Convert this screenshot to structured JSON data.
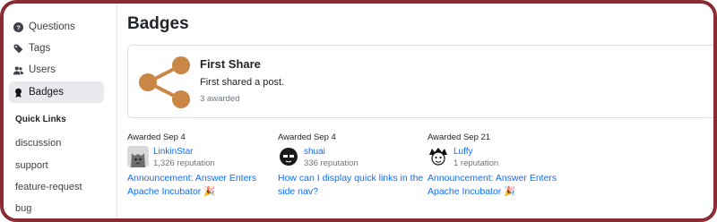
{
  "sidebar": {
    "items": [
      {
        "label": "Questions",
        "icon": "question-circle-icon"
      },
      {
        "label": "Tags",
        "icon": "tag-icon"
      },
      {
        "label": "Users",
        "icon": "people-icon"
      },
      {
        "label": "Badges",
        "icon": "award-icon"
      }
    ],
    "active": "Badges",
    "quick_links_title": "Quick Links",
    "quick_links": [
      "discussion",
      "support",
      "feature-request",
      "bug"
    ]
  },
  "main": {
    "title": "Badges",
    "badge": {
      "name": "First Share",
      "description": "First shared a post.",
      "awarded_count": "3 awarded",
      "icon": "share-icon",
      "icon_color": "#c98645"
    },
    "awards": [
      {
        "date": "Awarded Sep 4",
        "user": "LinkinStar",
        "reputation": "1,326 reputation",
        "post_line1": "Announcement: Answer Enters",
        "post_line2": "Apache Incubator 🎉"
      },
      {
        "date": "Awarded Sep 4",
        "user": "shuai",
        "reputation": "336 reputation",
        "post_line1": "How can I display quick links in the",
        "post_line2": "side nav?"
      },
      {
        "date": "Awarded Sep 21",
        "user": "Luffy",
        "reputation": "1 reputation",
        "post_line1": "Announcement: Answer Enters",
        "post_line2": "Apache Incubator 🎉"
      }
    ]
  },
  "colors": {
    "frame": "#8a2b35",
    "link": "#0d6efd",
    "active_nav_bg": "#e8eaed"
  }
}
